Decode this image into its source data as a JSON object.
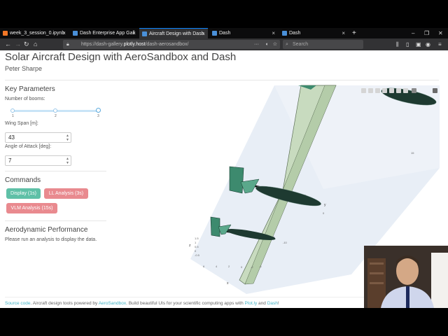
{
  "browser": {
    "tabs": [
      {
        "label": "week_3_session_0.ipynb",
        "icon_color": "#f37726"
      },
      {
        "label": "Dash Enterprise App Gall",
        "icon_color": "#4a90d9"
      },
      {
        "label": "Aircraft Design with Dash",
        "icon_color": "#4a90d9"
      },
      {
        "label": "Dash",
        "icon_color": "#4a90d9"
      },
      {
        "label": "Dash",
        "icon_color": "#4a90d9"
      }
    ],
    "new_tab": "+",
    "url_prefix": "https://dash-gallery.",
    "url_host": "plotly.host",
    "url_path": "/dash-aerosandbox/",
    "url_more": "···",
    "search_placeholder": "Search"
  },
  "page": {
    "title": "Solar Aircraft Design with AeroSandbox and Dash",
    "author": "Peter Sharpe",
    "key_parameters_heading": "Key Parameters",
    "booms_label": "Number of booms:",
    "booms_ticks": [
      "1",
      "2",
      "3"
    ],
    "booms_value": 3,
    "wingspan_label": "Wing Span [m]:",
    "wingspan_value": "43",
    "aoa_label": "Angle of Attack [deg]:",
    "aoa_value": "7",
    "commands_heading": "Commands",
    "buttons": {
      "display": "Display (1s)",
      "ll": "LL Analysis (3s)",
      "vlm": "VLM Analysis (15s)"
    },
    "colors": {
      "display": "#5fc0a7",
      "analysis": "#e98a8f",
      "wing_fill": "#c8dbbf",
      "tail_fill": "#3d8a6e",
      "link": "#45b5c7"
    },
    "perf_heading": "Aerodynamic Performance",
    "perf_text": "Please run an analysis to display the data.",
    "footer": {
      "source": "Source code",
      "t1": ". Aircraft design tools powered by ",
      "aerosandbox": "AeroSandbox",
      "t2": ". Build beautiful UIs for your scientific computing apps with ",
      "plotly": "Plot.ly",
      "t3": " and ",
      "dash": "Dash",
      "t4": "!"
    }
  },
  "plot": {
    "axis_labels": {
      "x": "x",
      "y": "y",
      "z": "z"
    },
    "z_ticks": [
      "1.5",
      "1",
      "0.5",
      "0",
      "-0.5"
    ],
    "x_ticks": [
      "6",
      "4",
      "2",
      "0",
      "-2",
      "-4"
    ],
    "right_ticks": [
      "15",
      "0",
      "-10"
    ]
  }
}
